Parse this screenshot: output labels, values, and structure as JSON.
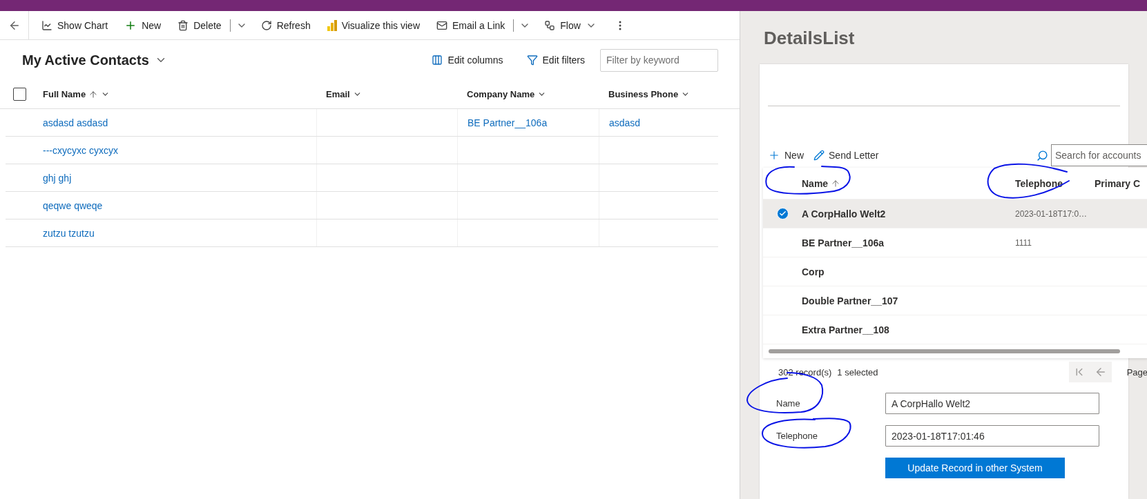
{
  "command_bar": {
    "items": [
      {
        "label": "Show Chart",
        "kind": "button"
      },
      {
        "label": "New",
        "kind": "button"
      },
      {
        "label": "Delete",
        "kind": "split"
      },
      {
        "label": "Refresh",
        "kind": "button"
      },
      {
        "label": "Visualize this view",
        "kind": "button"
      },
      {
        "label": "Email a Link",
        "kind": "split"
      },
      {
        "label": "Flow",
        "kind": "dropdown"
      }
    ]
  },
  "view": {
    "title": "My Active Contacts",
    "edit_columns": "Edit columns",
    "edit_filters": "Edit filters",
    "filter_placeholder": "Filter by keyword"
  },
  "grid": {
    "all_selected": false,
    "columns": [
      {
        "label": "Full Name",
        "sorted": true
      },
      {
        "label": "Email",
        "sorted": false
      },
      {
        "label": "Company Name",
        "sorted": false
      },
      {
        "label": "Business Phone",
        "sorted": false
      }
    ],
    "rows": [
      {
        "full_name": "asdasd asdasd",
        "company_name": "BE Partner__106a",
        "business_phone": "asdasd"
      },
      {
        "full_name": "---cxycyxc cyxcyx"
      },
      {
        "full_name": "ghj ghj"
      },
      {
        "full_name": "qeqwe qweqe"
      },
      {
        "full_name": "zutzu tzutzu"
      }
    ]
  },
  "details_panel": {
    "title": "DetailsList",
    "toolbar": [
      {
        "label": "New"
      },
      {
        "label": "Send Letter"
      }
    ],
    "search_placeholder": "Search for accounts",
    "columns": [
      {
        "label": "Name",
        "sorted": true
      },
      {
        "label": "Telephone",
        "sorted": false
      },
      {
        "label": "Primary C",
        "sorted": false
      }
    ],
    "rows": [
      {
        "name": "A CorpHallo Welt2",
        "telephone": "2023-01-18T17:0…",
        "selected": true
      },
      {
        "name": "BE Partner__106a",
        "telephone": "1111",
        "selected": false
      },
      {
        "name": "Corp",
        "selected": false
      },
      {
        "name": "Double Partner__107",
        "selected": false
      },
      {
        "name": "Extra Partner__108",
        "selected": false
      }
    ],
    "record_count": "302 record(s)",
    "selection_count": "1 selected",
    "page_label": "Page",
    "form": [
      {
        "label": "Name",
        "value": "A CorpHallo Welt2"
      },
      {
        "label": "Telephone",
        "value": "2023-01-18T17:01:46"
      }
    ],
    "submit": "Update Record in other System"
  }
}
